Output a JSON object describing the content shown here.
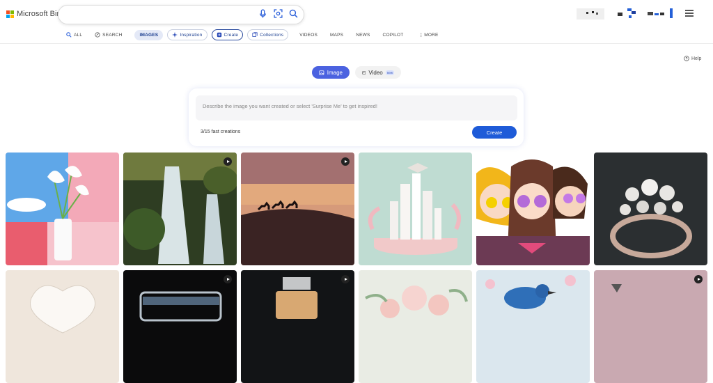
{
  "brand": {
    "name": "Microsoft Bing",
    "colors": [
      "#f25022",
      "#7fba00",
      "#00a4ef",
      "#ffb900"
    ]
  },
  "search": {
    "value": "",
    "icons": [
      "microphone-icon",
      "visual-search-icon",
      "search-icon"
    ]
  },
  "nav": {
    "items": [
      {
        "label": "ALL",
        "icon": "search-icon"
      },
      {
        "label": "SEARCH",
        "icon": "copilot-icon"
      },
      {
        "label": "IMAGES",
        "active": true
      },
      {
        "label": "Inspiration",
        "icon": "sparkle-icon"
      },
      {
        "label": "Create",
        "icon": "create-icon"
      },
      {
        "label": "Collections",
        "icon": "collections-icon"
      },
      {
        "label": "VIDEOS"
      },
      {
        "label": "MAPS"
      },
      {
        "label": "NEWS"
      },
      {
        "label": "COPILOT"
      },
      {
        "label": "MORE",
        "icon": "more-icon"
      }
    ]
  },
  "help": {
    "label": "Help"
  },
  "mode": {
    "image_label": "Image",
    "video_label": "Video",
    "video_badge": "new"
  },
  "creator": {
    "placeholder": "Describe the image you want created or select 'Surprise Me' to get inspired!",
    "counter": "3/15 fast creations",
    "create_label": "Create"
  },
  "gallery": {
    "row1": [
      {
        "name": "calla-lily-vase",
        "video": false
      },
      {
        "name": "waterfall",
        "video": true
      },
      {
        "name": "desert-camels-sunset",
        "video": true
      },
      {
        "name": "graduation-city-dome",
        "video": false
      },
      {
        "name": "anime-friends-sunglasses",
        "video": false
      },
      {
        "name": "pearl-ring",
        "video": false
      }
    ],
    "row2": [
      {
        "name": "white-heart-sculpture",
        "video": false
      },
      {
        "name": "glass-jar",
        "video": true
      },
      {
        "name": "perfume-bottle",
        "video": true
      },
      {
        "name": "paper-flowers",
        "video": false
      },
      {
        "name": "bluebird-blossoms",
        "video": false
      },
      {
        "name": "floating-island",
        "video": true
      }
    ]
  }
}
